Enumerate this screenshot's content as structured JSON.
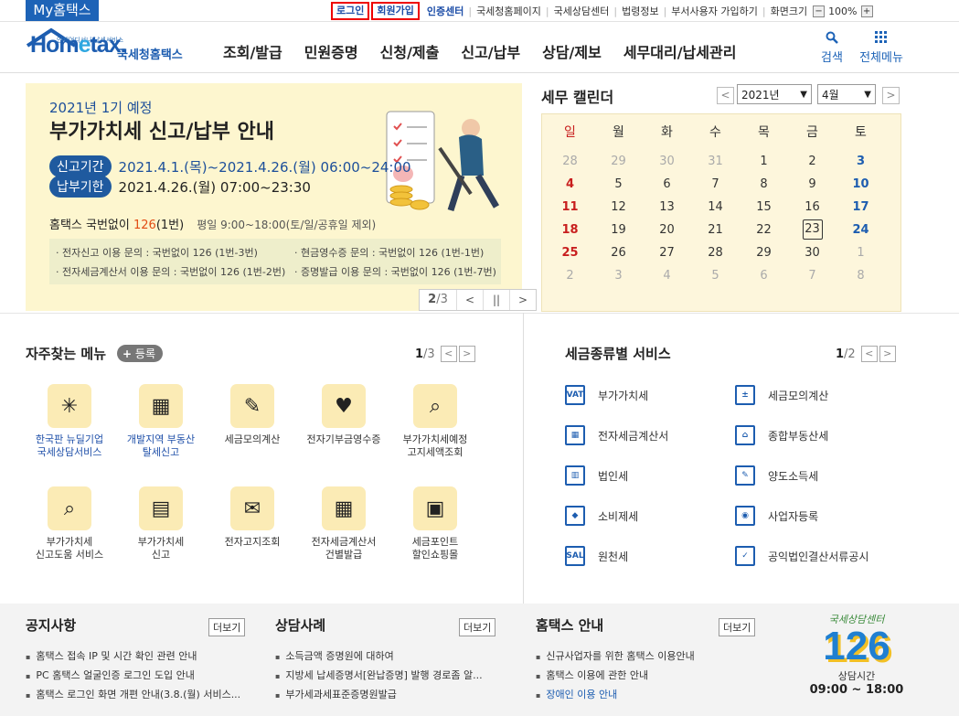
{
  "topbar": {
    "my_hometax": "My홈택스",
    "login": "로그인",
    "signup": "회원가입",
    "cert_center": "인증센터",
    "nts_homepage": "국세청홈페이지",
    "nts_consult": "국세상담센터",
    "law_info": "법령정보",
    "dept_signup": "부서사용자 가입하기",
    "screen_size": "화면크기",
    "zoom_minus": "−",
    "zoom_value": "100%",
    "zoom_plus": "+"
  },
  "header": {
    "logo_small": "언제어디서나 납세서비스",
    "logo_home": "Hom",
    "logo_e": "e",
    "logo_tax": "tax.",
    "logo_kor": "국세청홈택스",
    "nav": [
      "조회/발급",
      "민원증명",
      "신청/제출",
      "신고/납부",
      "상담/제보",
      "세무대리/납세관리"
    ],
    "search": "검색",
    "all_menu": "전체메뉴"
  },
  "banner": {
    "subtitle": "2021년 1기 예정",
    "title": "부가가치세 신고/납부 안내",
    "period_label": "신고기간",
    "period_value": "2021.4.1.(목)~2021.4.26.(월) 06:00~24:00",
    "deadline_label": "납부기한",
    "deadline_value": "2021.4.26.(월) 07:00~23:30",
    "contact_prefix": "홈택스 국번없이 ",
    "contact_num": "126",
    "contact_suffix": "(1번)",
    "contact_hours": "평일 9:00~18:00(토/일/공휴일 제외)",
    "info1": "· 전자신고 이용 문의 : 국번없이 126 (1번-3번)",
    "info2": "· 전자세금계산서 이용 문의 : 국번없이 126 (1번-2번)",
    "info3": "· 현금영수증 문의 : 국번없이 126 (1번-1번)",
    "info4": "· 증명발급 이용 문의 : 국번없이 126 (1번-7번)",
    "page_current": "2",
    "page_total": "/3"
  },
  "calendar": {
    "title": "세무 캘린더",
    "year": "2021년",
    "month": "4월",
    "weekdays": [
      "일",
      "월",
      "화",
      "수",
      "목",
      "금",
      "토"
    ],
    "days": [
      [
        "28",
        "29",
        "30",
        "31",
        "1",
        "2",
        "3"
      ],
      [
        "4",
        "5",
        "6",
        "7",
        "8",
        "9",
        "10"
      ],
      [
        "11",
        "12",
        "13",
        "14",
        "15",
        "16",
        "17"
      ],
      [
        "18",
        "19",
        "20",
        "21",
        "22",
        "23",
        "24"
      ],
      [
        "25",
        "26",
        "27",
        "28",
        "29",
        "30",
        "1"
      ],
      [
        "2",
        "3",
        "4",
        "5",
        "6",
        "7",
        "8"
      ]
    ],
    "today": "23"
  },
  "favorites": {
    "title": "자주찾는 메뉴",
    "add": "등록",
    "page_current": "1",
    "page_total": "/3",
    "items": [
      {
        "label1": "한국판 뉴딜기업",
        "label2": "국세상담서비스",
        "icon": "newdeal-icon"
      },
      {
        "label1": "개발지역 부동산",
        "label2": "탈세신고",
        "icon": "building-icon"
      },
      {
        "label1": "세금모의계산",
        "label2": "",
        "icon": "calculator-doc-icon"
      },
      {
        "label1": "전자기부금영수증",
        "label2": "",
        "icon": "donation-monitor-icon"
      },
      {
        "label1": "부가가치세예정",
        "label2": "고지세액조회",
        "icon": "vat-search-icon"
      },
      {
        "label1": "부가가치세",
        "label2": "신고도움 서비스",
        "icon": "vat-help-icon"
      },
      {
        "label1": "부가가치세",
        "label2": "신고",
        "icon": "vat-report-icon"
      },
      {
        "label1": "전자고지조회",
        "label2": "",
        "icon": "envelope-icon"
      },
      {
        "label1": "전자세금계산서",
        "label2": "건별발급",
        "icon": "invoice-icon"
      },
      {
        "label1": "세금포인트",
        "label2": "할인쇼핑몰",
        "icon": "shopping-bag-icon"
      }
    ]
  },
  "tax_services": {
    "title": "세금종류별 서비스",
    "page_current": "1",
    "page_total": "/2",
    "items": [
      {
        "label": "부가가치세",
        "icon": "vat-icon",
        "glyph": "VAT"
      },
      {
        "label": "세금모의계산",
        "icon": "calculator-icon",
        "glyph": "±"
      },
      {
        "label": "전자세금계산서",
        "icon": "e-invoice-icon",
        "glyph": "▦"
      },
      {
        "label": "종합부동산세",
        "icon": "real-estate-icon",
        "glyph": "⌂"
      },
      {
        "label": "법인세",
        "icon": "corporate-icon",
        "glyph": "▥"
      },
      {
        "label": "양도소득세",
        "icon": "transfer-icon",
        "glyph": "✎"
      },
      {
        "label": "소비제세",
        "icon": "diamond-icon",
        "glyph": "◆"
      },
      {
        "label": "사업자등록",
        "icon": "person-icon",
        "glyph": "◉"
      },
      {
        "label": "원천세",
        "icon": "salary-icon",
        "glyph": "SAL"
      },
      {
        "label": "공익법인결산서류공시",
        "icon": "clipboard-icon",
        "glyph": "✓"
      }
    ]
  },
  "footer": {
    "notice_title": "공지사항",
    "notice_items": [
      "홈택스 접속 IP 및 시간 확인 관련 안내",
      "PC 홈택스 얼굴인증 로그인 도입 안내",
      "홈택스 로그인 화면 개편 안내(3.8.(월) 서비스..."
    ],
    "consult_title": "상담사례",
    "consult_items": [
      "소득금액 증명원에 대하여",
      "지방세 납세증명서[완납증명] 발행 경로좀 알...",
      "부가세과세표준증명원발급"
    ],
    "guide_title": "홈택스 안내",
    "guide_items": [
      "신규사업자를 위한 홈택스 이용안내",
      "홈택스 이용에 관한 안내",
      "장애인 이용 안내"
    ],
    "more": "더보기",
    "cc_top": "국세상담센터",
    "cc_num": "126",
    "cc_label": "상담시간",
    "cc_hours": "09:00 ~ 18:00"
  }
}
